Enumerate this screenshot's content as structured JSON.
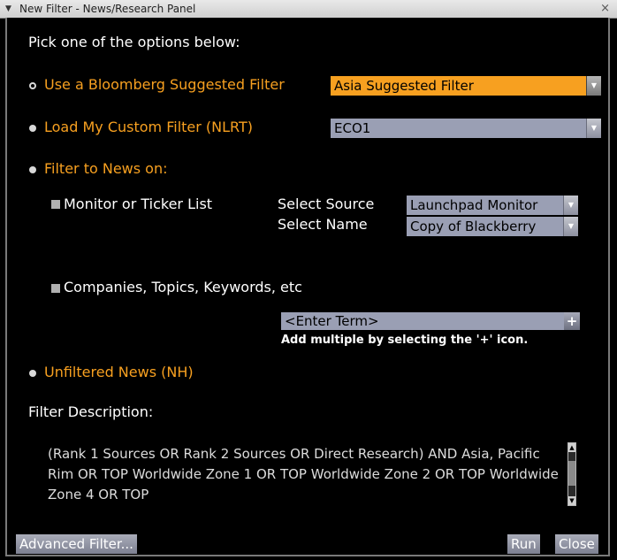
{
  "window": {
    "title": "New Filter - News/Research Panel"
  },
  "intro": "Pick one of the options below:",
  "options": {
    "suggested": {
      "label": "Use a Bloomberg Suggested Filter",
      "dropdown_value": "Asia Suggested Filter",
      "selected": true
    },
    "custom": {
      "label": "Load My Custom Filter (NLRT)",
      "dropdown_value": "ECO1"
    },
    "filter_news": {
      "label": "Filter to News on:"
    },
    "unfiltered": {
      "label": "Unfiltered News (NH)"
    }
  },
  "monitor": {
    "label": "Monitor or Ticker List",
    "source_label": "Select Source",
    "source_value": "Launchpad Monitor",
    "name_label": "Select Name",
    "name_value": "Copy of Blackberry"
  },
  "companies": {
    "label": "Companies, Topics, Keywords, etc",
    "term_placeholder": "<Enter Term>",
    "plus_label": "+",
    "hint": "Add multiple by selecting the '+' icon."
  },
  "description": {
    "heading": "Filter Description:",
    "text": "(Rank 1 Sources OR Rank 2 Sources OR Direct Research) AND Asia, Pacific Rim OR TOP Worldwide Zone 1 OR TOP Worldwide Zone 2 OR TOP Worldwide Zone 4 OR TOP"
  },
  "buttons": {
    "advanced": "Advanced Filter...",
    "run": "Run",
    "close": "Close"
  },
  "colors": {
    "accent_orange": "#f7a020",
    "field_grey": "#9a9fb4",
    "background": "#000000"
  }
}
